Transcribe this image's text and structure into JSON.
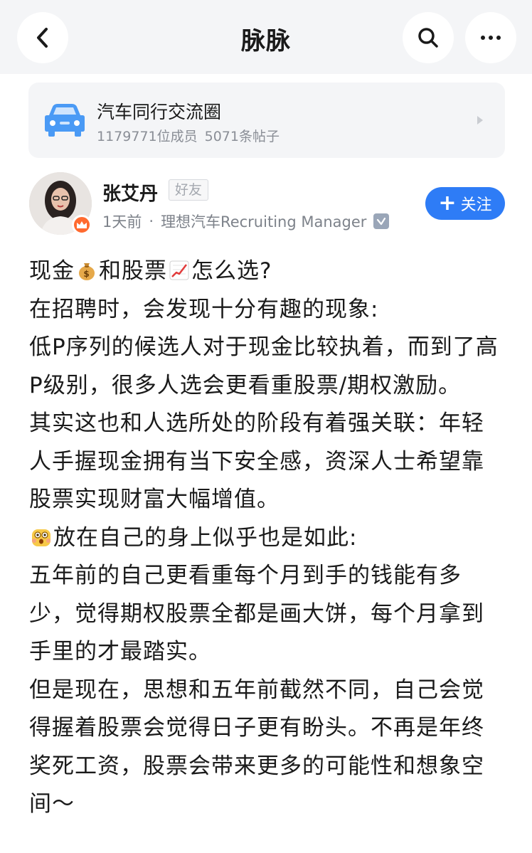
{
  "header": {
    "title": "脉脉",
    "back_icon": "chevron-left-icon",
    "search_icon": "search-icon",
    "more_icon": "more-horizontal-icon"
  },
  "circle": {
    "name": "汽车同行交流圈",
    "members": "1179771位成员",
    "posts": "5071条帖子",
    "icon": "car-icon"
  },
  "author": {
    "name": "张艾丹",
    "tag": "好友",
    "time": "1天前",
    "separator": "·",
    "title": "理想汽车Recruiting Manager",
    "badge_icon": "crown-icon",
    "verified_icon": "verified-icon"
  },
  "follow": {
    "label": "关注"
  },
  "post": {
    "line1_a": "现金",
    "line1_b": "和股票",
    "line1_c": "怎么选?",
    "para1": "在招聘时，会发现十分有趣的现象:",
    "para2": "低P序列的候选人对于现金比较执着，而到了高P级别，很多人选会更看重股票/期权激励。",
    "para3": "其实这也和人选所处的阶段有着强关联：年轻人手握现金拥有当下安全感，资深人士希望靠股票实现财富大幅增值。",
    "para4": "放在自己的身上似乎也是如此:",
    "para5": "五年前的自己更看重每个月到手的钱能有多少，觉得期权股票全都是画大饼，每个月拿到手里的才最踏实。",
    "para6": "但是现在，思想和五年前截然不同，自己会觉得握着股票会觉得日子更有盼头。不再是年终奖死工资，股票会带来更多的可能性和想象空间～"
  },
  "colors": {
    "accent": "#2e7cf6",
    "header_bg": "#f4f5f7",
    "muted": "#8a8e96",
    "badge": "#ff6a2f"
  }
}
